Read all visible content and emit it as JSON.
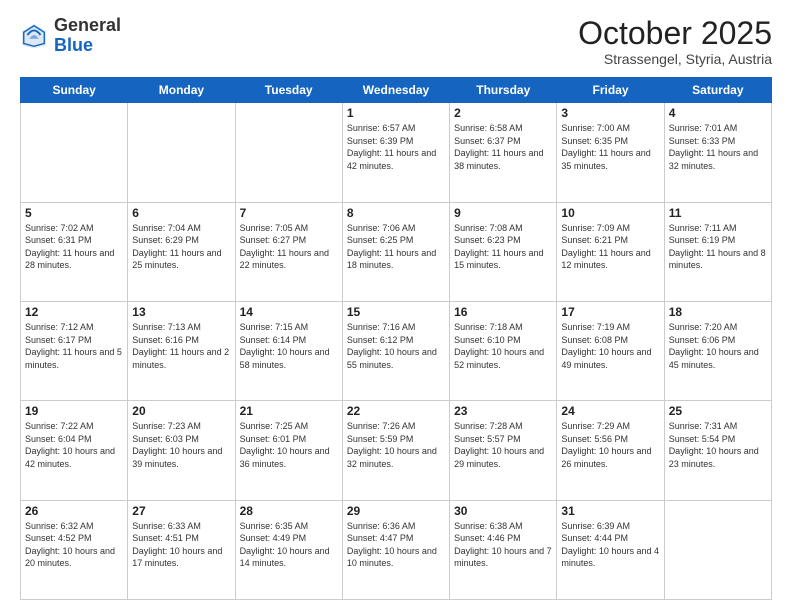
{
  "header": {
    "logo_general": "General",
    "logo_blue": "Blue",
    "month_title": "October 2025",
    "location": "Strassengel, Styria, Austria"
  },
  "days_of_week": [
    "Sunday",
    "Monday",
    "Tuesday",
    "Wednesday",
    "Thursday",
    "Friday",
    "Saturday"
  ],
  "weeks": [
    [
      {
        "num": "",
        "info": ""
      },
      {
        "num": "",
        "info": ""
      },
      {
        "num": "",
        "info": ""
      },
      {
        "num": "1",
        "info": "Sunrise: 6:57 AM\nSunset: 6:39 PM\nDaylight: 11 hours and 42 minutes."
      },
      {
        "num": "2",
        "info": "Sunrise: 6:58 AM\nSunset: 6:37 PM\nDaylight: 11 hours and 38 minutes."
      },
      {
        "num": "3",
        "info": "Sunrise: 7:00 AM\nSunset: 6:35 PM\nDaylight: 11 hours and 35 minutes."
      },
      {
        "num": "4",
        "info": "Sunrise: 7:01 AM\nSunset: 6:33 PM\nDaylight: 11 hours and 32 minutes."
      }
    ],
    [
      {
        "num": "5",
        "info": "Sunrise: 7:02 AM\nSunset: 6:31 PM\nDaylight: 11 hours and 28 minutes."
      },
      {
        "num": "6",
        "info": "Sunrise: 7:04 AM\nSunset: 6:29 PM\nDaylight: 11 hours and 25 minutes."
      },
      {
        "num": "7",
        "info": "Sunrise: 7:05 AM\nSunset: 6:27 PM\nDaylight: 11 hours and 22 minutes."
      },
      {
        "num": "8",
        "info": "Sunrise: 7:06 AM\nSunset: 6:25 PM\nDaylight: 11 hours and 18 minutes."
      },
      {
        "num": "9",
        "info": "Sunrise: 7:08 AM\nSunset: 6:23 PM\nDaylight: 11 hours and 15 minutes."
      },
      {
        "num": "10",
        "info": "Sunrise: 7:09 AM\nSunset: 6:21 PM\nDaylight: 11 hours and 12 minutes."
      },
      {
        "num": "11",
        "info": "Sunrise: 7:11 AM\nSunset: 6:19 PM\nDaylight: 11 hours and 8 minutes."
      }
    ],
    [
      {
        "num": "12",
        "info": "Sunrise: 7:12 AM\nSunset: 6:17 PM\nDaylight: 11 hours and 5 minutes."
      },
      {
        "num": "13",
        "info": "Sunrise: 7:13 AM\nSunset: 6:16 PM\nDaylight: 11 hours and 2 minutes."
      },
      {
        "num": "14",
        "info": "Sunrise: 7:15 AM\nSunset: 6:14 PM\nDaylight: 10 hours and 58 minutes."
      },
      {
        "num": "15",
        "info": "Sunrise: 7:16 AM\nSunset: 6:12 PM\nDaylight: 10 hours and 55 minutes."
      },
      {
        "num": "16",
        "info": "Sunrise: 7:18 AM\nSunset: 6:10 PM\nDaylight: 10 hours and 52 minutes."
      },
      {
        "num": "17",
        "info": "Sunrise: 7:19 AM\nSunset: 6:08 PM\nDaylight: 10 hours and 49 minutes."
      },
      {
        "num": "18",
        "info": "Sunrise: 7:20 AM\nSunset: 6:06 PM\nDaylight: 10 hours and 45 minutes."
      }
    ],
    [
      {
        "num": "19",
        "info": "Sunrise: 7:22 AM\nSunset: 6:04 PM\nDaylight: 10 hours and 42 minutes."
      },
      {
        "num": "20",
        "info": "Sunrise: 7:23 AM\nSunset: 6:03 PM\nDaylight: 10 hours and 39 minutes."
      },
      {
        "num": "21",
        "info": "Sunrise: 7:25 AM\nSunset: 6:01 PM\nDaylight: 10 hours and 36 minutes."
      },
      {
        "num": "22",
        "info": "Sunrise: 7:26 AM\nSunset: 5:59 PM\nDaylight: 10 hours and 32 minutes."
      },
      {
        "num": "23",
        "info": "Sunrise: 7:28 AM\nSunset: 5:57 PM\nDaylight: 10 hours and 29 minutes."
      },
      {
        "num": "24",
        "info": "Sunrise: 7:29 AM\nSunset: 5:56 PM\nDaylight: 10 hours and 26 minutes."
      },
      {
        "num": "25",
        "info": "Sunrise: 7:31 AM\nSunset: 5:54 PM\nDaylight: 10 hours and 23 minutes."
      }
    ],
    [
      {
        "num": "26",
        "info": "Sunrise: 6:32 AM\nSunset: 4:52 PM\nDaylight: 10 hours and 20 minutes."
      },
      {
        "num": "27",
        "info": "Sunrise: 6:33 AM\nSunset: 4:51 PM\nDaylight: 10 hours and 17 minutes."
      },
      {
        "num": "28",
        "info": "Sunrise: 6:35 AM\nSunset: 4:49 PM\nDaylight: 10 hours and 14 minutes."
      },
      {
        "num": "29",
        "info": "Sunrise: 6:36 AM\nSunset: 4:47 PM\nDaylight: 10 hours and 10 minutes."
      },
      {
        "num": "30",
        "info": "Sunrise: 6:38 AM\nSunset: 4:46 PM\nDaylight: 10 hours and 7 minutes."
      },
      {
        "num": "31",
        "info": "Sunrise: 6:39 AM\nSunset: 4:44 PM\nDaylight: 10 hours and 4 minutes."
      },
      {
        "num": "",
        "info": ""
      }
    ]
  ]
}
